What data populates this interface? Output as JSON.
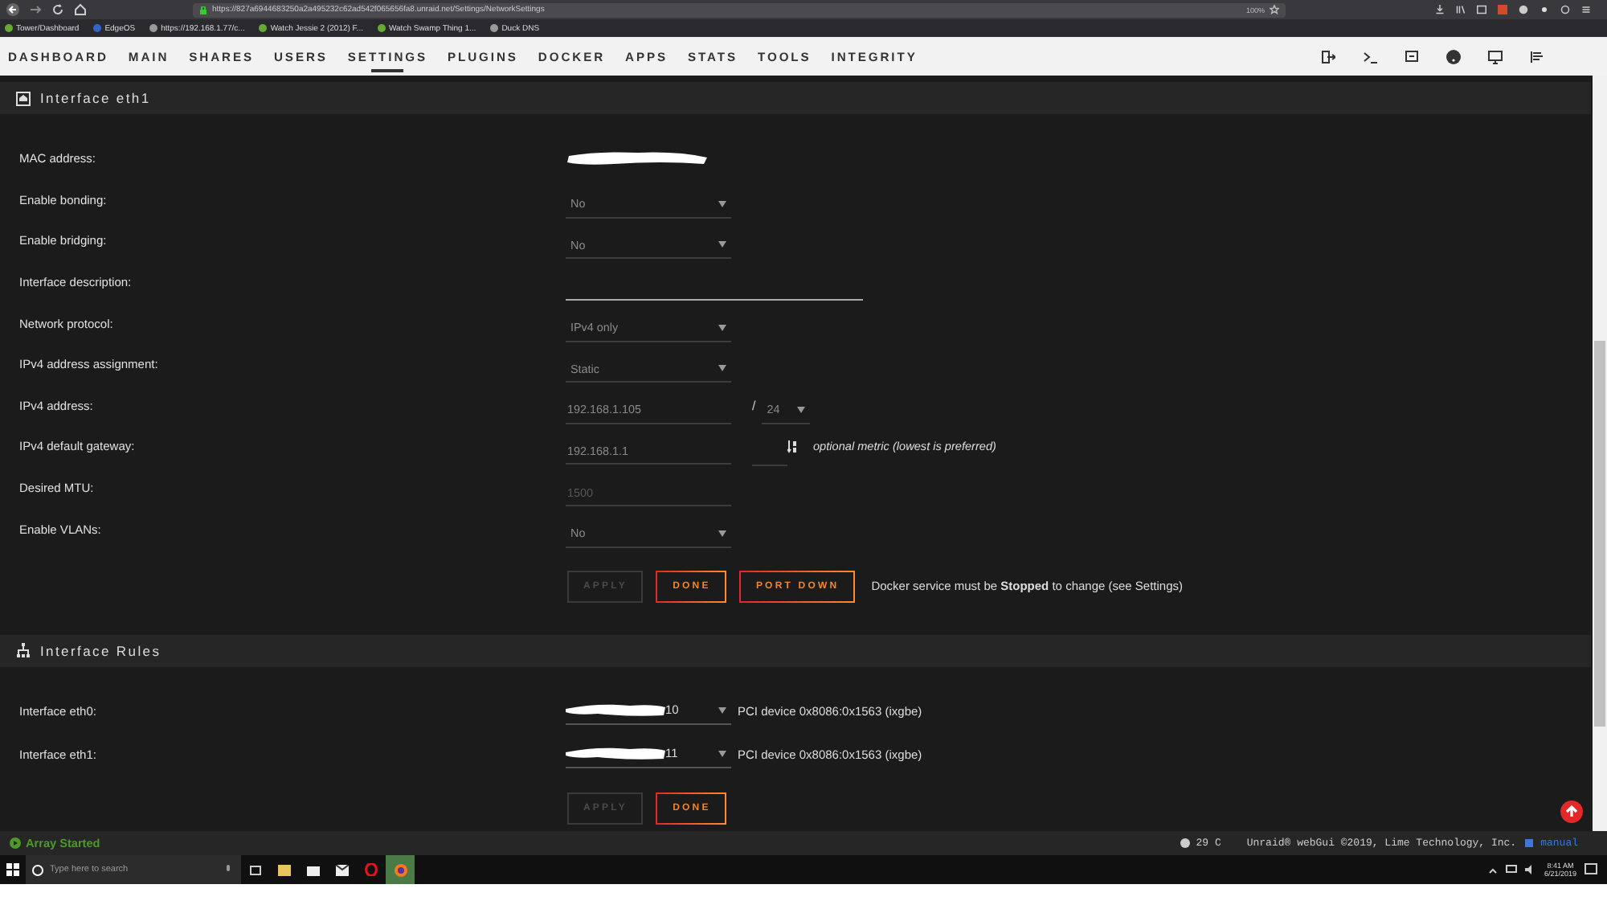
{
  "browser": {
    "url": "https://827a6944683250a2a495232c62ad542f065656fa8.unraid.net/Settings/NetworkSettings",
    "zoom": "100%",
    "bookmarks": [
      "Tower/Dashboard",
      "EdgeOS",
      "https://192.168.1.77/c...",
      "Watch Jessie 2 (2012) F...",
      "Watch Swamp Thing 1...",
      "Duck DNS"
    ]
  },
  "nav": {
    "tabs": [
      {
        "label": "DASHBOARD",
        "selected": false
      },
      {
        "label": "MAIN",
        "selected": false
      },
      {
        "label": "SHARES",
        "selected": false
      },
      {
        "label": "USERS",
        "selected": false
      },
      {
        "label": "SETTINGS",
        "selected": true
      },
      {
        "label": "PLUGINS",
        "selected": false
      },
      {
        "label": "DOCKER",
        "selected": false
      },
      {
        "label": "APPS",
        "selected": false
      },
      {
        "label": "STATS",
        "selected": false
      },
      {
        "label": "TOOLS",
        "selected": false
      },
      {
        "label": "INTEGRITY",
        "selected": false
      }
    ]
  },
  "interface_eth1": {
    "title": "Interface eth1",
    "fields": [
      {
        "label": "MAC address:",
        "kind": "redacted"
      },
      {
        "label": "Enable bonding:",
        "kind": "select",
        "value": "No"
      },
      {
        "label": "Enable bridging:",
        "kind": "select",
        "value": "No"
      },
      {
        "label": "Interface description:",
        "kind": "text"
      },
      {
        "label": "Network protocol:",
        "kind": "select",
        "value": "IPv4 only"
      },
      {
        "label": "IPv4 address assignment:",
        "kind": "select",
        "value": "Static"
      },
      {
        "label": "IPv4 address:",
        "kind": "address",
        "value": "192.168.1.105",
        "separator": "/",
        "prefix": "24"
      },
      {
        "label": "IPv4 default gateway:",
        "kind": "gateway",
        "value": "192.168.1.1",
        "note": "optional metric (lowest is preferred)"
      },
      {
        "label": "Desired MTU:",
        "kind": "input",
        "placeholder": "1500"
      },
      {
        "label": "Enable VLANs:",
        "kind": "select",
        "value": "No"
      }
    ],
    "buttons": [
      {
        "label": "APPLY",
        "disabled": true
      },
      {
        "label": "DONE",
        "disabled": false
      },
      {
        "label": "PORT DOWN",
        "disabled": false
      }
    ],
    "note": "Docker service must be **Stopped** to change (see Settings)"
  },
  "interface_rules": {
    "title": "Interface Rules",
    "rows": [
      {
        "label": "Interface eth0:",
        "value": "10",
        "description": "PCI device 0x8086:0x1563 (ixgbe)"
      },
      {
        "label": "Interface eth1:",
        "value": "11",
        "description": "PCI device 0x8086:0x1563 (ixgbe)"
      }
    ],
    "buttons": [
      {
        "label": "APPLY",
        "disabled": true
      },
      {
        "label": "DONE",
        "disabled": false
      }
    ]
  },
  "status_bar": {
    "array_status": "Array Started",
    "temperature": "29 C",
    "copyright": "Unraid® webGui ©2019, Lime Technology, Inc.",
    "manual_link": "manual"
  },
  "taskbar": {
    "search_placeholder": "Type here to search",
    "time": "8:41 AM",
    "date": "6/21/2019"
  }
}
